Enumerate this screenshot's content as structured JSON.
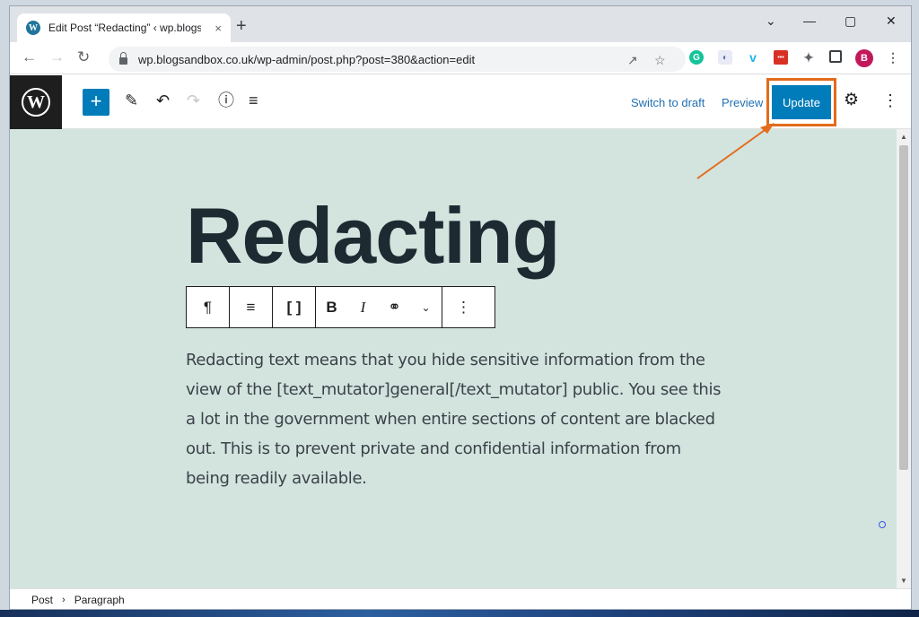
{
  "browser": {
    "tab_title": "Edit Post “Redacting” ‹ wp.blogsa",
    "tab_close": "×",
    "new_tab": "+",
    "window_controls": [
      "⌄",
      "—",
      "▢",
      "✕"
    ],
    "url": "wp.blogsandbox.co.uk/wp-admin/post.php?post=380&action=edit",
    "profile_initial": "B"
  },
  "editor": {
    "switch_to_draft": "Switch to draft",
    "preview": "Preview",
    "update": "Update",
    "accent_color": "#007cba",
    "highlight_color": "#e36b1c"
  },
  "post": {
    "title": "Redacting",
    "body": "Redacting text means that you hide sensitive information from the view of the [text_mutator]general[/text_mutator] public. You see this a lot in the government when entire sections of content are blacked out. This is to prevent private and confidential information from being readily available."
  },
  "block_toolbar": {
    "paragraph_icon": "¶",
    "bold": "B",
    "italic": "I"
  },
  "breadcrumb": {
    "items": [
      "Post",
      "Paragraph"
    ],
    "separator": "›"
  }
}
